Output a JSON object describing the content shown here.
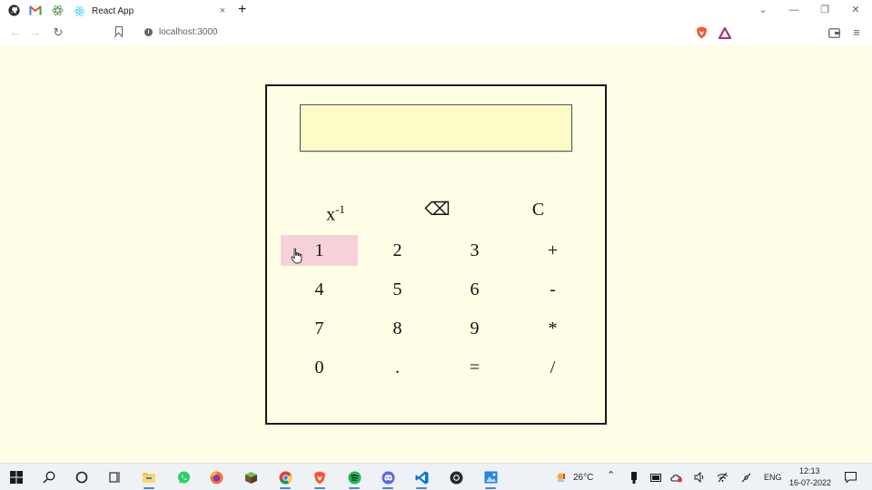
{
  "browser": {
    "tab_title": "React App",
    "tab_close": "×",
    "new_tab": "+",
    "url": "localhost:3000",
    "window_controls": [
      "⌄",
      "—",
      "❐",
      "✕"
    ],
    "nav": {
      "back": "←",
      "forward": "→",
      "reload": "↻"
    },
    "menu_icon": "≡",
    "icons": [
      "github-icon",
      "gmail-icon",
      "extension-icon",
      "react-icon",
      "brave-shield-icon",
      "brave-rewards-icon",
      "wallet-icon"
    ]
  },
  "calculator": {
    "display_value": "",
    "function_keys": [
      {
        "label": "x",
        "sup": "-1",
        "name": "reciprocal-button"
      },
      {
        "label": "⌫",
        "name": "backspace-button"
      },
      {
        "label": "C",
        "name": "clear-button"
      }
    ],
    "keys": [
      [
        "1",
        "2",
        "3",
        "+"
      ],
      [
        "4",
        "5",
        "6",
        "-"
      ],
      [
        "7",
        "8",
        "9",
        "*"
      ],
      [
        "0",
        ".",
        "=",
        "/"
      ]
    ],
    "hovered_key": "1",
    "colors": {
      "background": "#fefee6",
      "display": "#fdfcc8",
      "hover": "#f6d2d8"
    }
  },
  "taskbar": {
    "weather": "26°C",
    "language": "ENG",
    "time": "12:13",
    "date": "16-07-2022",
    "apps": [
      "windows-start-icon",
      "search-icon",
      "cortana-icon",
      "task-view-icon",
      "file-explorer-icon",
      "whatsapp-icon",
      "firefox-icon",
      "minecraft-icon",
      "chrome-icon",
      "brave-icon",
      "spotify-icon",
      "discord-icon",
      "vscode-icon",
      "github-desktop-icon",
      "photos-icon"
    ]
  }
}
